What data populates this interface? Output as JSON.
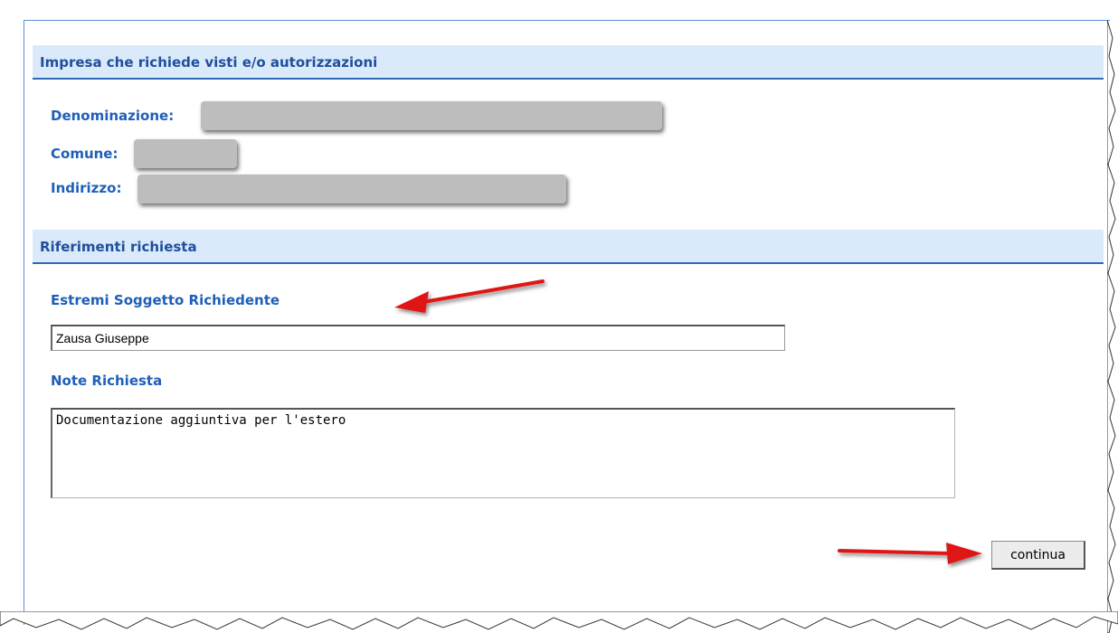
{
  "sections": {
    "impresa": {
      "title": "Impresa che richiede visti e/o autorizzazioni",
      "denominazione_label": "Denominazione:",
      "comune_label": "Comune:",
      "indirizzo_label": "Indirizzo:"
    },
    "riferimenti": {
      "title": "Riferimenti richiesta",
      "soggetto_label": "Estremi Soggetto Richiedente",
      "soggetto_value": "Zausa Giuseppe",
      "note_label": "Note Richiesta",
      "note_value": "Documentazione aggiuntiva per l'estero"
    }
  },
  "actions": {
    "continue_label": "continua"
  },
  "colors": {
    "header_bg": "#dbeafa",
    "header_border": "#2e6ab8",
    "label_blue": "#1f5fb8",
    "annotation_arrow": "#e01515"
  }
}
